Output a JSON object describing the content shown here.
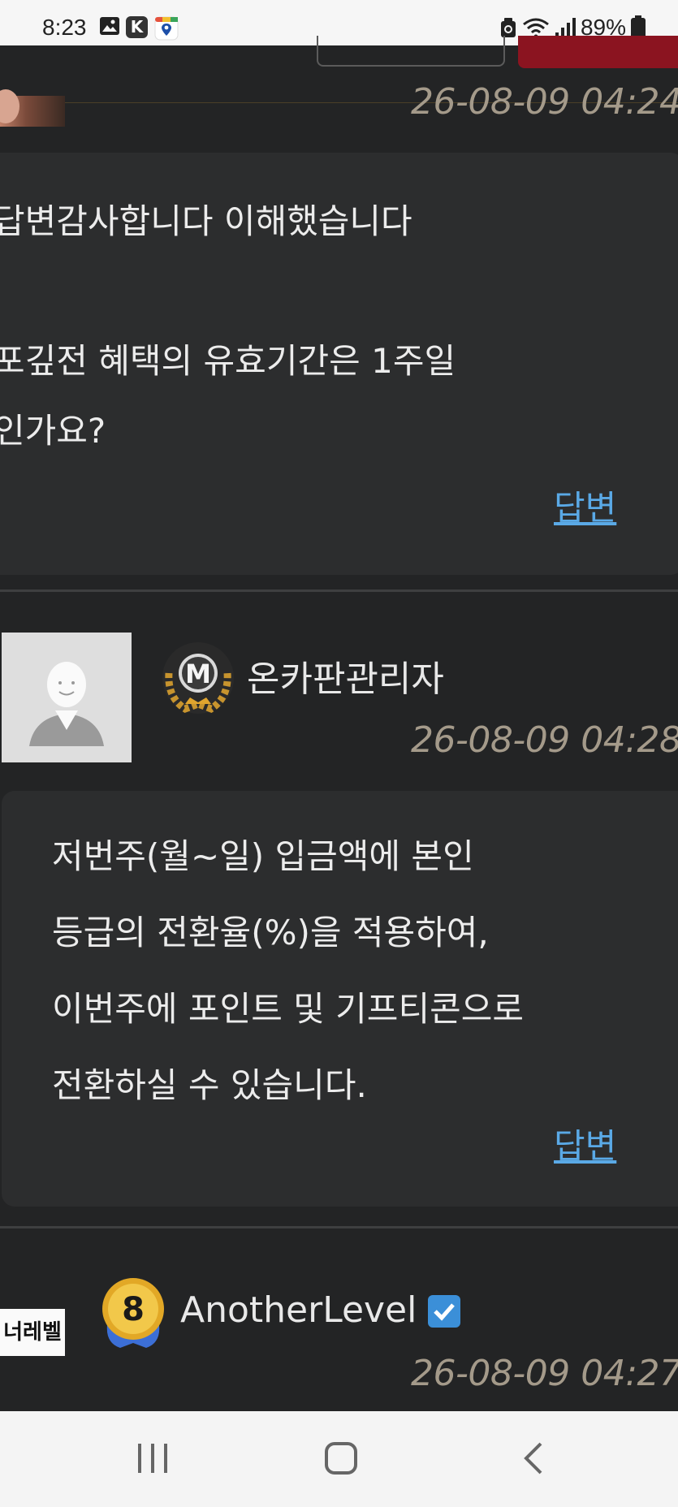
{
  "status_bar": {
    "time": "8:23",
    "battery": "89%",
    "icons": [
      "gallery-icon",
      "kakao-k-icon",
      "map-pin-icon",
      "recycle-icon",
      "wifi-icon",
      "signal-icon",
      "battery-icon"
    ],
    "k_letter": "K"
  },
  "comments": [
    {
      "timestamp": "26-08-09 04:24",
      "body_lines": [
        "답변감사합니다 이해했습니다",
        "",
        "포깊전 혜택의 유효기간은 1주일",
        "인가요?"
      ],
      "reply_label": "답변"
    },
    {
      "author": "온카판관리자",
      "badge_letter": "M",
      "timestamp": "26-08-09 04:28",
      "body_lines": [
        "저번주(월~일) 입금액에 본인",
        "등급의 전환율(%)을 적용하여,",
        "이번주에 포인트 및 기프티콘으로",
        "전환하실 수 있습니다."
      ],
      "reply_label": "답변"
    },
    {
      "author": "AnotherLevel",
      "badge_number": "8",
      "avatar_label": "너레벨",
      "timestamp": "26-08-09 04:27"
    }
  ],
  "nav": {
    "items": [
      "recent-apps-icon",
      "home-icon",
      "back-icon"
    ]
  },
  "colors": {
    "background": "#232425",
    "card": "#2c2d2e",
    "link": "#5aa9e6",
    "timestamp": "#a49a8a",
    "accent_red": "#8b1420",
    "verified": "#3b8fd8"
  }
}
